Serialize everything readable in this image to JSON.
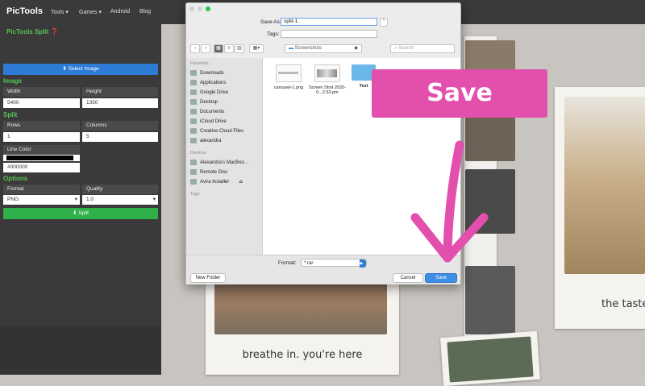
{
  "app": {
    "brand": "PicTools",
    "nav": [
      "Tools ▾",
      "Games ▾",
      "Android",
      "Blog"
    ]
  },
  "sidebar": {
    "title": "PicTools Split",
    "select_image": "Select Image",
    "image_heading": "Image",
    "width_label": "Width",
    "width_value": "5400",
    "height_label": "Height",
    "height_value": "1350",
    "split_heading": "Split",
    "rows_label": "Rows",
    "rows_value": "1",
    "columns_label": "Columns",
    "columns_value": "5",
    "line_color_label": "Line Color",
    "line_color_value": "#000000",
    "options_heading": "Options",
    "format_label": "Format",
    "format_value": "PNG",
    "quality_label": "Quality",
    "quality_value": "1.0",
    "split_button": "Split"
  },
  "canvas": {
    "caption_left": "breathe in. you're here",
    "caption_right": "the taste"
  },
  "dialog": {
    "save_as_label": "Save As:",
    "save_as_value": "split-1",
    "tags_label": "Tags:",
    "location": "Screenshots",
    "search_placeholder": "Search",
    "favorites_heading": "Favorites",
    "favorites": [
      "Downloads",
      "Applications",
      "Google Drive",
      "Desktop",
      "Documents",
      "iCloud Drive",
      "Creative Cloud Files",
      "alexandra"
    ],
    "devices_heading": "Devices",
    "devices": [
      "Alexandra's MacBoo...",
      "Remote Disc",
      "Avira Installer"
    ],
    "tags_heading": "Tags",
    "files": [
      {
        "name": "carousel-1.png"
      },
      {
        "name": "Screen Shot 2020-0...2.53 pm"
      },
      {
        "name": "Test"
      }
    ],
    "format_label": "Format:",
    "format_value": "*.rar",
    "new_folder": "New Folder",
    "cancel": "Cancel",
    "save": "Save"
  },
  "overlay": {
    "label": "Save",
    "color": "#e34fad"
  }
}
